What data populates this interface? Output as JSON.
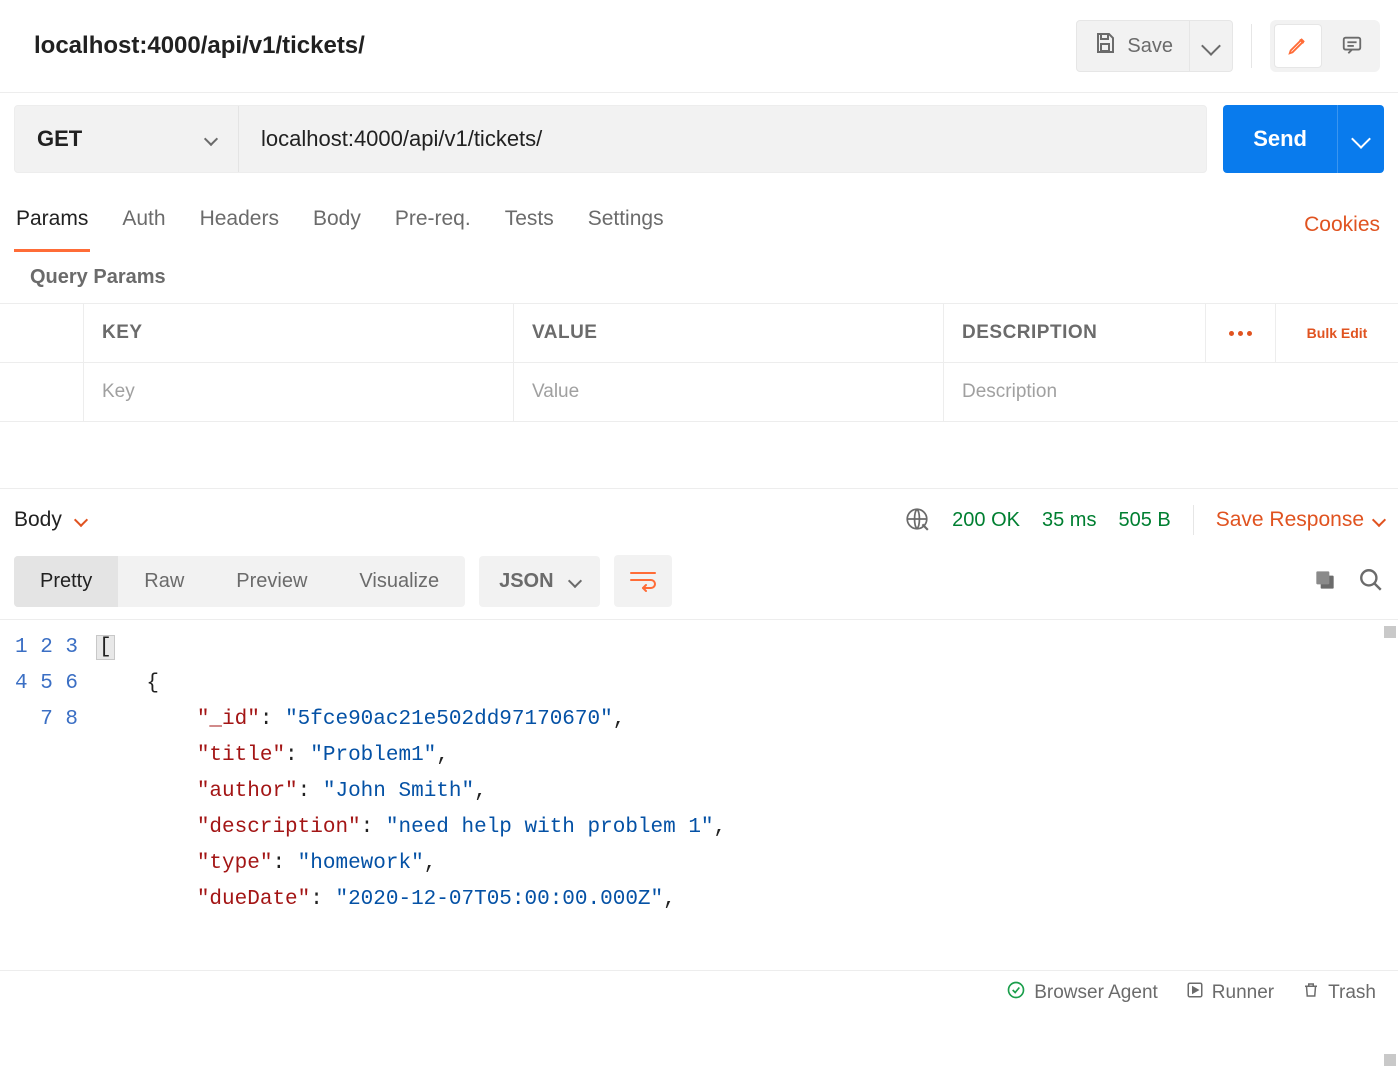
{
  "header": {
    "title": "localhost:4000/api/v1/tickets/",
    "save_label": "Save"
  },
  "request": {
    "method": "GET",
    "url": "localhost:4000/api/v1/tickets/",
    "send_label": "Send"
  },
  "tabs": {
    "params": "Params",
    "auth": "Auth",
    "headers": "Headers",
    "body": "Body",
    "prereq": "Pre-req.",
    "tests": "Tests",
    "settings": "Settings",
    "cookies": "Cookies"
  },
  "query_params": {
    "heading": "Query Params",
    "col_key": "KEY",
    "col_value": "VALUE",
    "col_desc": "DESCRIPTION",
    "bulk_edit": "Bulk Edit",
    "ph_key": "Key",
    "ph_value": "Value",
    "ph_desc": "Description"
  },
  "response": {
    "tab_label": "Body",
    "status": "200 OK",
    "time": "35 ms",
    "size": "505 B",
    "save_response": "Save Response",
    "view_pretty": "Pretty",
    "view_raw": "Raw",
    "view_preview": "Preview",
    "view_visualize": "Visualize",
    "format": "JSON",
    "body": [
      {
        "n": 1,
        "indent": 0,
        "open_bracket": "["
      },
      {
        "n": 2,
        "indent": 1,
        "open_brace": "{"
      },
      {
        "n": 3,
        "indent": 2,
        "key": "_id",
        "value": "5fce90ac21e502dd97170670",
        "comma": true
      },
      {
        "n": 4,
        "indent": 2,
        "key": "title",
        "value": "Problem1",
        "comma": true
      },
      {
        "n": 5,
        "indent": 2,
        "key": "author",
        "value": "John Smith",
        "comma": true
      },
      {
        "n": 6,
        "indent": 2,
        "key": "description",
        "value": "need help with problem 1",
        "comma": true
      },
      {
        "n": 7,
        "indent": 2,
        "key": "type",
        "value": "homework",
        "comma": true
      },
      {
        "n": 8,
        "indent": 2,
        "key": "dueDate",
        "value": "2020-12-07T05:00:00.000Z",
        "comma": true,
        "cutoff": true
      }
    ]
  },
  "bottombar": {
    "agent": "Browser Agent",
    "runner": "Runner",
    "trash": "Trash"
  }
}
